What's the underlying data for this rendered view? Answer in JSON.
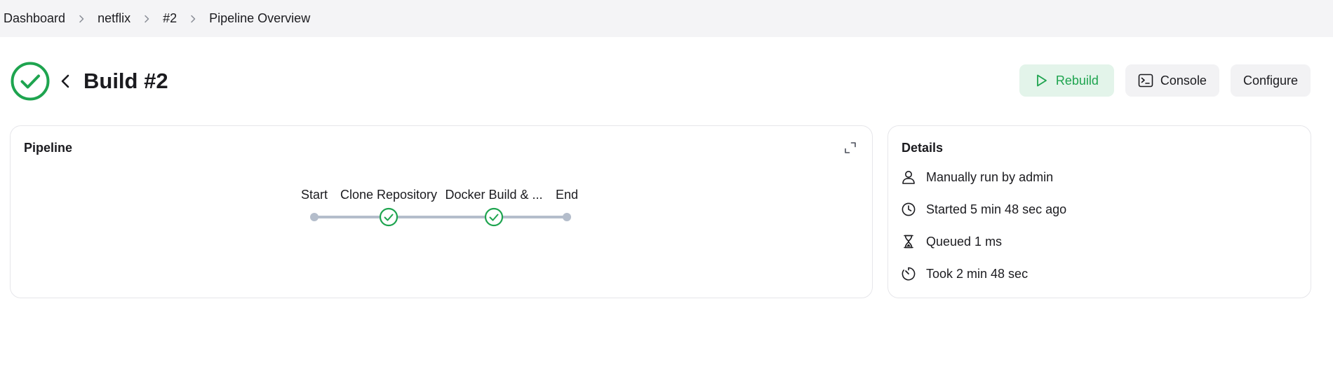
{
  "breadcrumb": {
    "items": [
      "Dashboard",
      "netflix",
      "#2",
      "Pipeline Overview"
    ]
  },
  "header": {
    "title": "Build #2",
    "status": "success",
    "status_icon": "check-circle-icon",
    "back_icon": "chevron-left-icon"
  },
  "actions": {
    "rebuild_label": "Rebuild",
    "console_label": "Console",
    "configure_label": "Configure"
  },
  "pipeline": {
    "title": "Pipeline",
    "expand_icon": "expand-icon",
    "stages": [
      {
        "label": "Start",
        "kind": "terminal"
      },
      {
        "label": "Clone Repository",
        "kind": "success"
      },
      {
        "label": "Docker Build & ...",
        "kind": "success"
      },
      {
        "label": "End",
        "kind": "terminal"
      }
    ]
  },
  "details": {
    "title": "Details",
    "rows": [
      {
        "icon": "person-icon",
        "text": "Manually run by admin"
      },
      {
        "icon": "clock-icon",
        "text": "Started 5 min 48 sec ago"
      },
      {
        "icon": "hourglass-icon",
        "text": "Queued 1 ms"
      },
      {
        "icon": "timer-icon",
        "text": "Took 2 min 48 sec"
      }
    ]
  },
  "colors": {
    "success": "#1ea44f",
    "rebuild_bg": "#e3f4ea",
    "button_bg": "#f2f2f4",
    "breadcrumb_bg": "#f4f4f6",
    "pipeline_line": "#b4bdcb"
  }
}
